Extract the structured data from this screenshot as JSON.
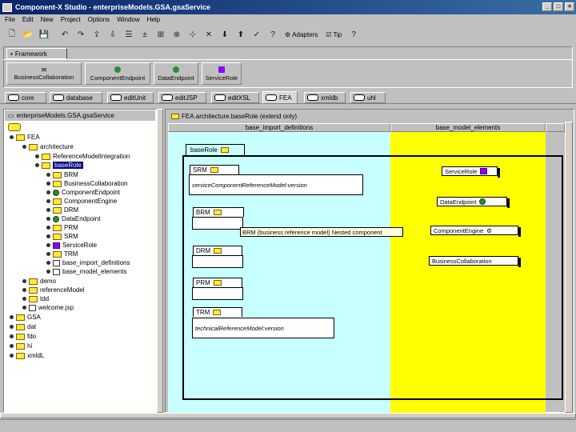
{
  "window": {
    "title": "Component-X Studio - enterpriseModels.GSA.gsaService"
  },
  "menu": [
    "File",
    "Edit",
    "New",
    "Project",
    "Options",
    "Window",
    "Help"
  ],
  "toolbar": {
    "adapters_label": "Adapters",
    "tip_label": "Tip",
    "help_glyph": "?"
  },
  "framework": {
    "tab_label": "Framework",
    "items": [
      "BusinessCollaboration",
      "ComponentEndpoint",
      "DataEndpoint",
      "ServiceRole"
    ]
  },
  "tabs": [
    "core",
    "database",
    "editUnit",
    "editJSP",
    "editXSL",
    "FEA",
    "xmldb",
    "uhl"
  ],
  "tree": {
    "header": "enterpriseModels.GSA.gsaService",
    "rows": [
      "FEA",
      "architecture",
      "ReferenceModelIntegration",
      "baseRole",
      "BRM",
      "BusinessCollaboration",
      "ComponentEndpoint",
      "ComponentEngine",
      "DRM",
      "DataEndpoint",
      "PRM",
      "SRM",
      "ServiceRole",
      "TRM",
      "base_import_definitions",
      "base_model_elements",
      "demo",
      "referenceModel",
      "tdd",
      "welcome.jsp",
      "GSA",
      "dat",
      "fdo",
      "hi",
      "xmldL"
    ]
  },
  "editor": {
    "header": "FEA.architecture.baseRole (extend only)",
    "col_left": "base_import_definitions",
    "col_right": "base_model_elements",
    "base_tab": "baseRole",
    "components": [
      {
        "tab": "SRM",
        "body": "serviceComponentReferenceModel:version"
      },
      {
        "tab": "BRM",
        "body": ""
      },
      {
        "tab": "DRM",
        "body": ""
      },
      {
        "tab": "PRM",
        "body": ""
      },
      {
        "tab": "TRM",
        "body": "technicalReferenceModel:version"
      }
    ],
    "tooltip": "BRM (business reference model) Nested component",
    "elements": [
      "ServiceRole",
      "DataEndpoint",
      "ComponentEngine",
      "BusinessCollaboration"
    ]
  },
  "colors": {
    "cyan": "#c8ffff",
    "yellow": "#ffff00",
    "titlebar": "#0a246a"
  }
}
